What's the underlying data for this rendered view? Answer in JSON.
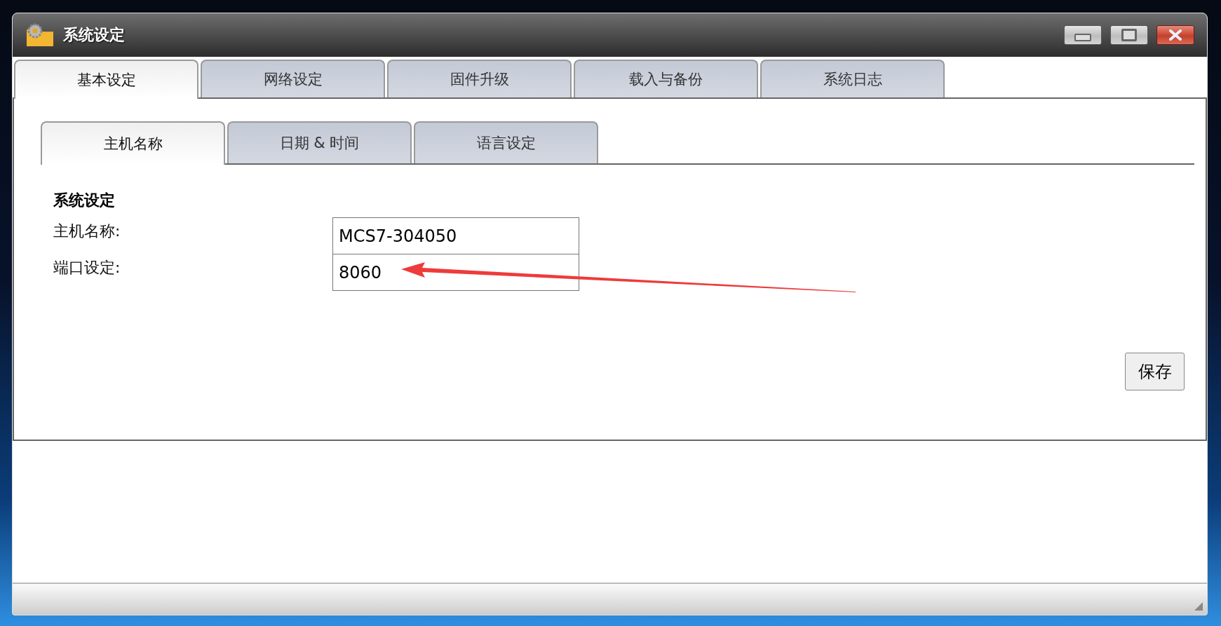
{
  "window": {
    "title": "系统设定"
  },
  "tabs": [
    {
      "label": "基本设定",
      "selected": true
    },
    {
      "label": "网络设定",
      "selected": false
    },
    {
      "label": "固件升级",
      "selected": false
    },
    {
      "label": "载入与备份",
      "selected": false
    },
    {
      "label": "系统日志",
      "selected": false
    }
  ],
  "subtabs": [
    {
      "label": "主机名称",
      "selected": true
    },
    {
      "label": "日期 & 时间",
      "selected": false
    },
    {
      "label": "语言设定",
      "selected": false
    }
  ],
  "section": {
    "title": "系统设定",
    "fields": [
      {
        "label": "主机名称:",
        "value": "MCS7-304050"
      },
      {
        "label": "端口设定:",
        "value": "8060"
      }
    ]
  },
  "save_button": "保存"
}
